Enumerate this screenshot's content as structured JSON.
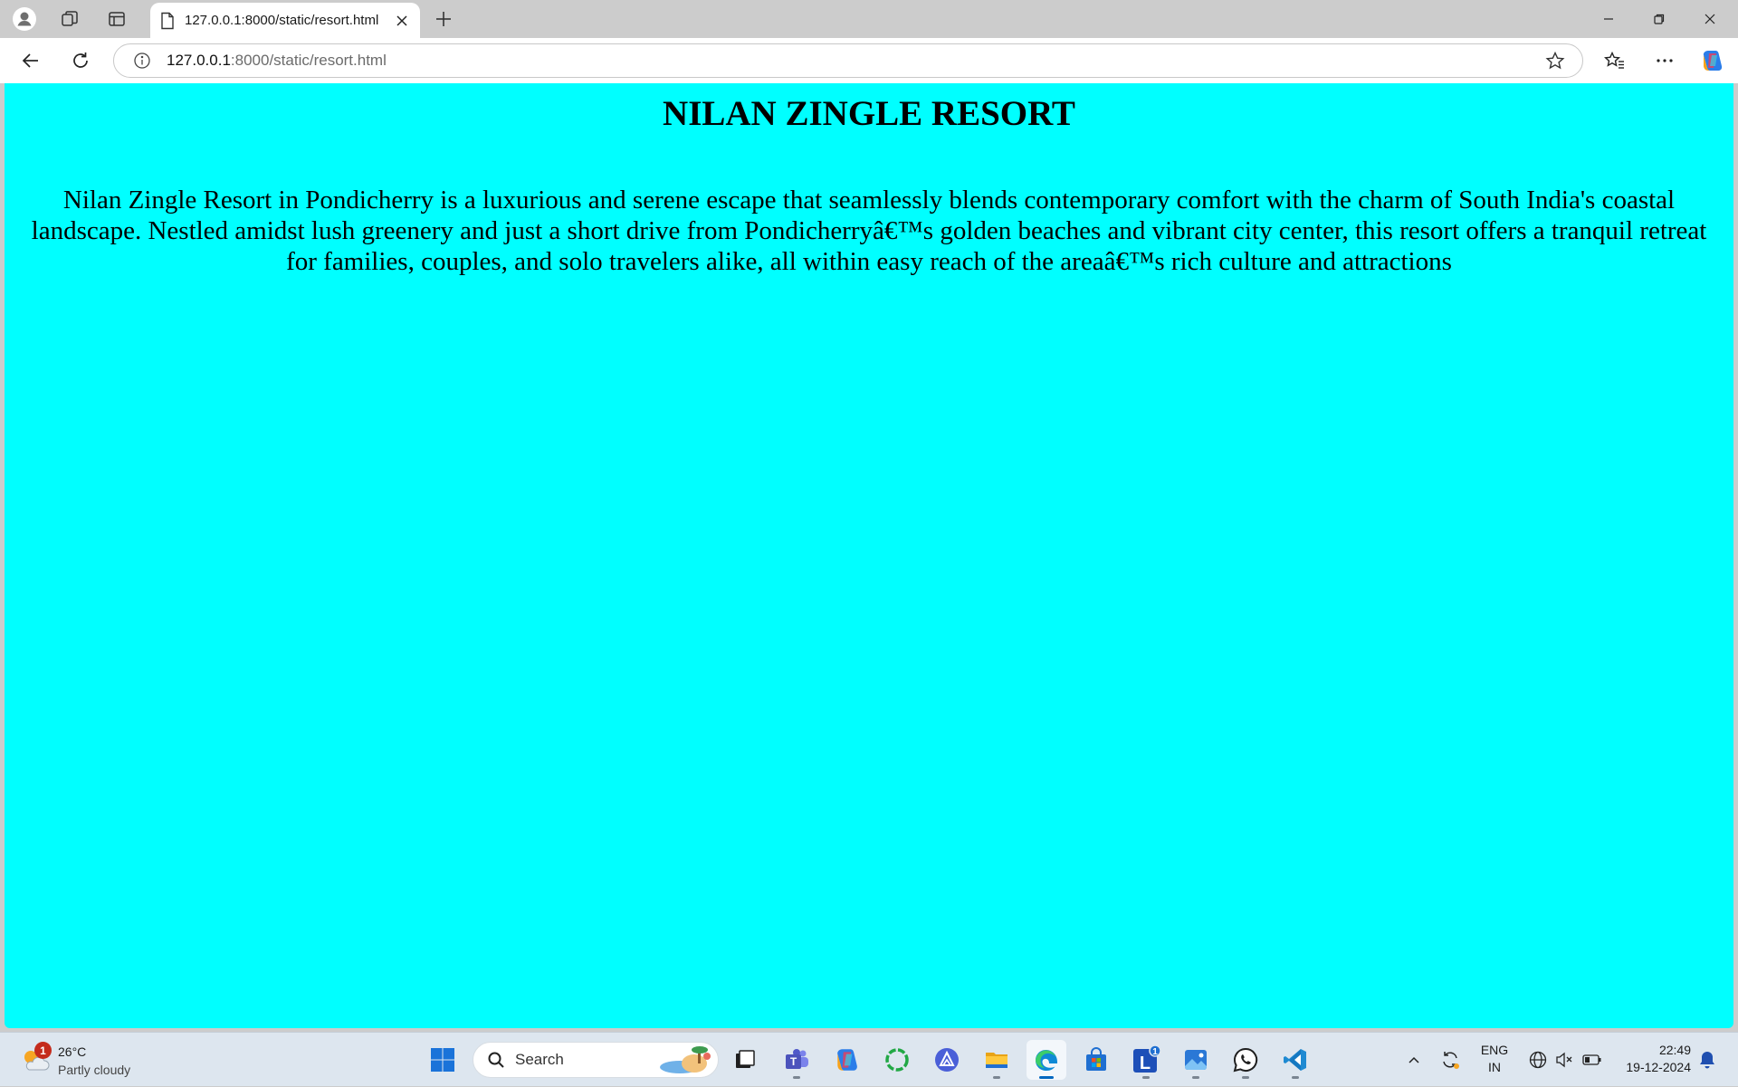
{
  "browser": {
    "tab": {
      "title": "127.0.0.1:8000/static/resort.html"
    },
    "address_bar": {
      "url_host": "127.0.0.1",
      "url_rest": ":8000/static/resort.html"
    }
  },
  "page": {
    "heading": "NILAN ZINGLE RESORT",
    "description": "Nilan Zingle Resort in Pondicherry is a luxurious and serene escape that seamlessly blends contemporary comfort with the charm of South India's coastal landscape. Nestled amidst lush greenery and just a short drive from Pondicherryâ€™s golden beaches and vibrant city center, this resort offers a tranquil retreat for families, couples, and solo travelers alike, all within easy reach of the areaâ€™s rich culture and attractions",
    "background_color": "#00ffff"
  },
  "taskbar": {
    "weather": {
      "temperature": "26°C",
      "condition": "Partly cloudy",
      "badge": "1"
    },
    "search": {
      "label": "Search"
    },
    "apps": [
      {
        "name": "windows-start-icon"
      },
      {
        "name": "task-view-icon"
      },
      {
        "name": "teams-icon"
      },
      {
        "name": "copilot-icon"
      },
      {
        "name": "green-circle-app-icon"
      },
      {
        "name": "triangle-app-icon"
      },
      {
        "name": "file-explorer-icon"
      },
      {
        "name": "edge-icon",
        "active": true
      },
      {
        "name": "microsoft-store-icon"
      },
      {
        "name": "l-app-icon",
        "badge": "1"
      },
      {
        "name": "photos-app-icon"
      },
      {
        "name": "whatsapp-icon"
      },
      {
        "name": "vscode-icon"
      }
    ],
    "tray": {
      "language_line1": "ENG",
      "language_line2": "IN",
      "time": "22:49",
      "date": "19-12-2024"
    }
  },
  "colors": {
    "page_bg": "#00ffff",
    "accent": "#0067c0",
    "badge": "#c42b1c"
  }
}
